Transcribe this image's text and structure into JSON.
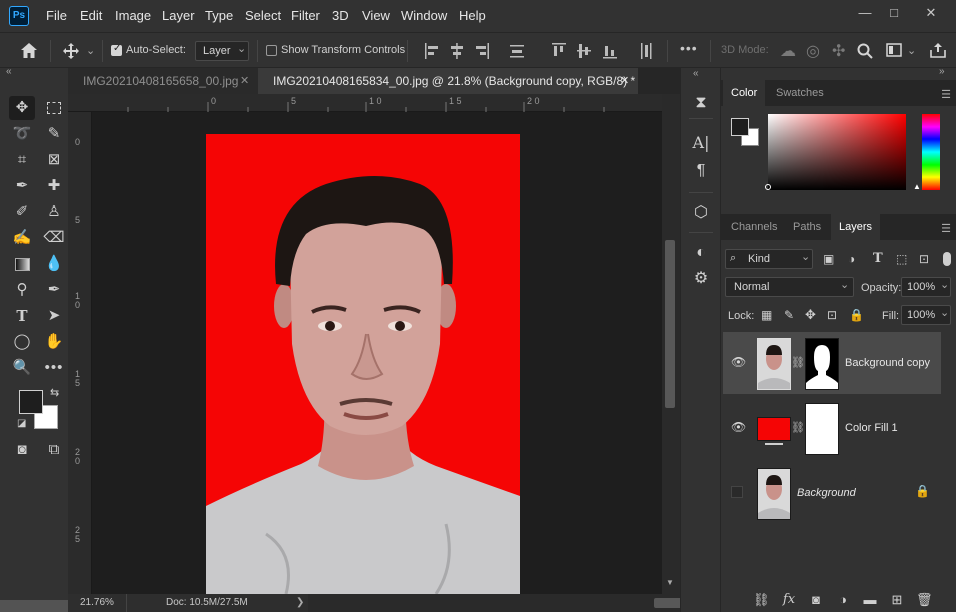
{
  "app": {
    "logo_text": "Ps"
  },
  "menu": [
    "File",
    "Edit",
    "Image",
    "Layer",
    "Type",
    "Select",
    "Filter",
    "3D",
    "View",
    "Window",
    "Help"
  ],
  "window_controls": {
    "minimize": "—",
    "restore": "□",
    "close": "✕"
  },
  "options_bar": {
    "auto_select_label": "Auto-Select:",
    "auto_select_checked": true,
    "auto_select_target": "Layer",
    "show_transform_label": "Show Transform Controls",
    "show_transform_checked": false,
    "more": "•••",
    "mode_3d_label": "3D Mode:"
  },
  "tabs": [
    {
      "title": "IMG20210408165658_00.jpg",
      "close": "✕",
      "active": false
    },
    {
      "title": "IMG20210408165834_00.jpg @ 21.8% (Background copy, RGB/8) *",
      "close": "✕",
      "active": true
    }
  ],
  "rulers": {
    "horizontal": [
      "0",
      "5",
      "1 0",
      "1 5",
      "2 0"
    ],
    "vertical": [
      "0",
      "5",
      "1 0",
      "1 5",
      "2 0",
      "2 5"
    ]
  },
  "status": {
    "zoom": "21.76%",
    "doc": "Doc: 10.5M/27.5M",
    "arrow": "❯"
  },
  "color_panel": {
    "tabs": [
      "Color",
      "Swatches"
    ],
    "active_tab": "Color",
    "foreground": "#1e1e1e",
    "background": "#ffffff",
    "ramp_hue": "#ff0000"
  },
  "layers_panel": {
    "tabs": [
      "Channels",
      "Paths",
      "Layers"
    ],
    "active_tab": "Layers",
    "filter_kind": "Kind",
    "blend_mode": "Normal",
    "opacity_label": "Opacity:",
    "opacity_value": "100%",
    "lock_label": "Lock:",
    "fill_label": "Fill:",
    "fill_value": "100%",
    "layers": [
      {
        "name": "Background copy",
        "visible": true,
        "selected": true,
        "locked": false,
        "italic": false
      },
      {
        "name": "Color Fill 1",
        "visible": true,
        "selected": false,
        "locked": false,
        "italic": false,
        "fill_color": "#f50505"
      },
      {
        "name": "Background",
        "visible": false,
        "selected": false,
        "locked": true,
        "italic": true
      }
    ]
  },
  "colors": {
    "canvas_red": "#f50505",
    "accent": "#31a8ff"
  }
}
